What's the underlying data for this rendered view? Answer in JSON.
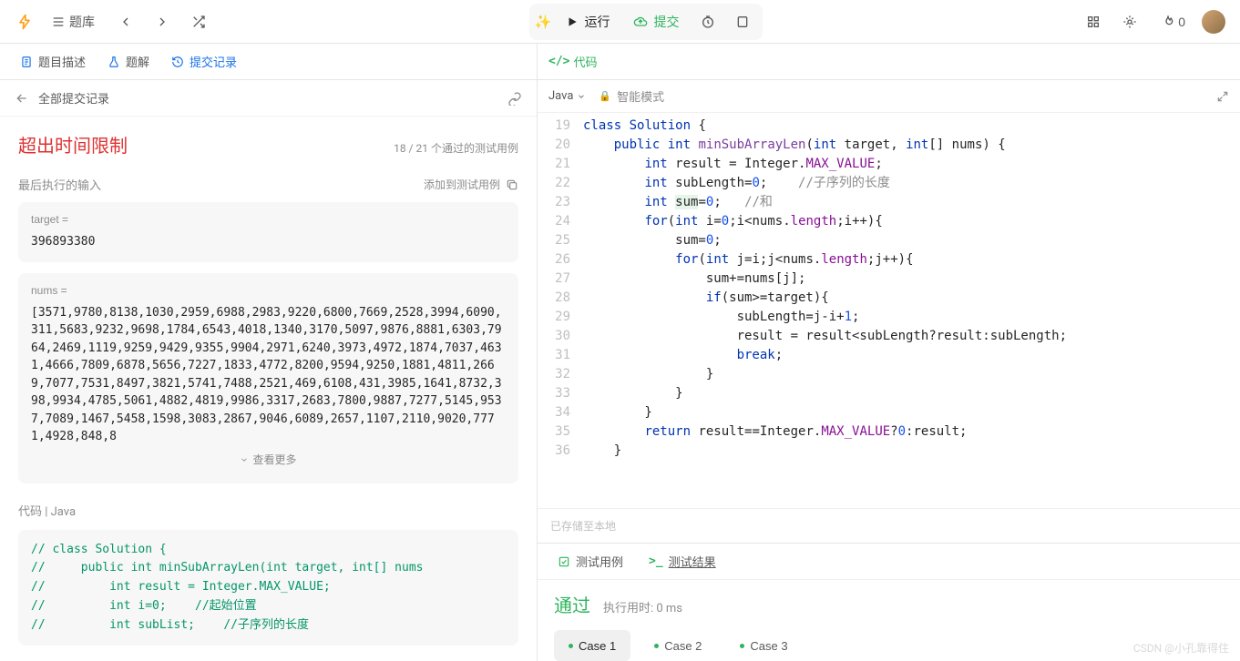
{
  "topbar": {
    "problems_label": "题库",
    "run_label": "运行",
    "submit_label": "提交",
    "fire_count": "0"
  },
  "left": {
    "tabs": {
      "desc": "题目描述",
      "solution": "题解",
      "history": "提交记录"
    },
    "all_submissions": "全部提交记录",
    "status": "超出时间限制",
    "status_sub": "18 / 21 个通过的测试用例",
    "last_input_label": "最后执行的输入",
    "add_testcase": "添加到测试用例",
    "target_label": "target =",
    "target_value": "396893380",
    "nums_label": "nums =",
    "nums_value": "[3571,9780,8138,1030,2959,6988,2983,9220,6800,7669,2528,3994,6090,311,5683,9232,9698,1784,6543,4018,1340,3170,5097,9876,8881,6303,7964,2469,1119,9259,9429,9355,9904,2971,6240,3973,4972,1874,7037,4631,4666,7809,6878,5656,7227,1833,4772,8200,9594,9250,1881,4811,2669,7077,7531,8497,3821,5741,7488,2521,469,6108,431,3985,1641,8732,398,9934,4785,5061,4882,4819,9986,3317,2683,7800,9887,7277,5145,9537,7089,1467,5458,1598,3083,2867,9046,6089,2657,1107,2110,9020,7771,4928,848,8",
    "see_more": "查看更多",
    "code_section_label": "代码 | Java",
    "snippet": {
      "l1": "// class Solution {",
      "l2": "//     public int minSubArrayLen(int target, int[] nums",
      "l3": "//         int result = Integer.MAX_VALUE;",
      "l4a": "//         int i=0;    ",
      "l4b": "//起始位置",
      "l5a": "//         int subList;    ",
      "l5b": "//子序列的长度"
    }
  },
  "right": {
    "code_label": "代码",
    "lang": "Java",
    "smart_mode": "智能模式",
    "save_status": "已存储至本地",
    "editor": [
      {
        "n": 19,
        "h": "<span class='e-kw'>class</span> <span class='e-ty'>Solution</span> {"
      },
      {
        "n": 20,
        "h": "    <span class='e-kw'>public</span> <span class='e-kw'>int</span> <span class='e-fn'>minSubArrayLen</span>(<span class='e-kw'>int</span> target, <span class='e-kw'>int</span>[] nums) {"
      },
      {
        "n": 21,
        "h": "        <span class='e-kw'>int</span> result = Integer.<span class='e-fld'>MAX_VALUE</span>;"
      },
      {
        "n": 22,
        "h": "        <span class='e-kw'>int</span> subLength=<span class='e-num'>0</span>;    <span class='e-cm'>//子序列的长度</span>"
      },
      {
        "n": 23,
        "h": "        <span class='e-kw'>int</span> <span style='background:#e6f4ea'>sum</span>=<span class='e-num'>0</span>;   <span class='e-cm'>//和</span>"
      },
      {
        "n": 24,
        "h": "        <span class='e-kw'>for</span>(<span class='e-kw'>int</span> i=<span class='e-num'>0</span>;i&lt;nums.<span class='e-fld'>length</span>;i++){"
      },
      {
        "n": 25,
        "h": "            sum=<span class='e-num'>0</span>;"
      },
      {
        "n": 26,
        "h": "            <span class='e-kw'>for</span>(<span class='e-kw'>int</span> j=i;j&lt;nums.<span class='e-fld'>length</span>;j++){"
      },
      {
        "n": 27,
        "h": "                sum+=nums[j];"
      },
      {
        "n": 28,
        "h": "                <span class='e-kw'>if</span>(sum&gt;=target){"
      },
      {
        "n": 29,
        "h": "                    subLength=j-i+<span class='e-num'>1</span>;"
      },
      {
        "n": 30,
        "h": "                    result = result&lt;subLength?result:subLength;"
      },
      {
        "n": 31,
        "h": "                    <span class='e-kw'>break</span>;"
      },
      {
        "n": 32,
        "h": "                }"
      },
      {
        "n": 33,
        "h": "            }"
      },
      {
        "n": 34,
        "h": "        }"
      },
      {
        "n": 35,
        "h": "        <span class='e-kw'>return</span> result==Integer.<span class='e-fld'>MAX_VALUE</span>?<span class='e-num'>0</span>:result;"
      },
      {
        "n": 36,
        "h": "    }"
      }
    ],
    "test_tabs": {
      "cases": "测试用例",
      "result": "测试结果"
    },
    "result": {
      "pass": "通过",
      "time": "执行用时: 0 ms",
      "case1": "Case 1",
      "case2": "Case 2",
      "case3": "Case 3"
    }
  },
  "watermark": "CSDN @小孔靠得住"
}
